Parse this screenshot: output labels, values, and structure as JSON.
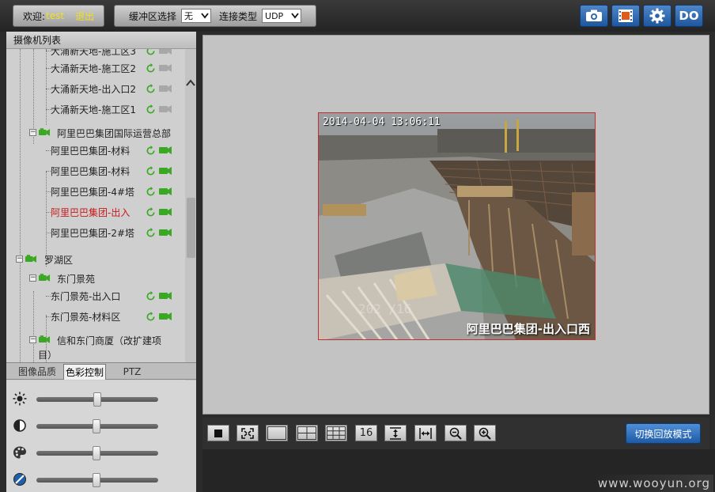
{
  "topbar": {
    "welcome_label": "欢迎:",
    "username": "test",
    "logout_label": "退出",
    "buffer_label": "缓冲区选择",
    "buffer_value": "无",
    "conn_label": "连接类型",
    "conn_value": "UDP",
    "do_label": "DO",
    "icons": [
      "camera-icon",
      "film-icon",
      "gear-icon",
      "do-icon"
    ]
  },
  "camera_list": {
    "title": "摄像机列表",
    "items": [
      {
        "label": "大涌新天地-施工区3",
        "status": "offline"
      },
      {
        "label": "大涌新天地-施工区2",
        "status": "offline"
      },
      {
        "label": "大涌新天地-出入口2",
        "status": "offline"
      },
      {
        "label": "大涌新天地-施工区1",
        "status": "offline"
      },
      {
        "label": "阿里巴巴集团国际运营总部",
        "type": "group"
      },
      {
        "label": "阿里巴巴集团-材料",
        "status": "online"
      },
      {
        "label": "阿里巴巴集团-材料",
        "status": "online"
      },
      {
        "label": "阿里巴巴集团-4#塔",
        "status": "online"
      },
      {
        "label": "阿里巴巴集团-出入",
        "status": "online",
        "selected": true
      },
      {
        "label": "阿里巴巴集团-2#塔",
        "status": "online"
      },
      {
        "label": "罗湖区",
        "type": "group"
      },
      {
        "label": "东门景苑",
        "type": "group"
      },
      {
        "label": "东门景苑-出入口",
        "status": "online"
      },
      {
        "label": "东门景苑-材料区",
        "status": "online"
      },
      {
        "label": "信和东门商厦（改扩建项",
        "type": "group"
      },
      {
        "label": "目）",
        "type": "continuation"
      }
    ],
    "colors": {
      "selected": "#c81a1a",
      "online": "#3aa822",
      "offline": "#a8a8a8"
    }
  },
  "tabs": [
    {
      "label": "图像品质"
    },
    {
      "label": "色彩控制",
      "active": true
    },
    {
      "label": "PTZ"
    }
  ],
  "sliders": [
    {
      "name": "brightness",
      "icon": "sun-icon",
      "value": 0.5
    },
    {
      "name": "contrast",
      "icon": "contrast-icon",
      "value": 0.49
    },
    {
      "name": "saturation",
      "icon": "palette-icon",
      "value": 0.49
    },
    {
      "name": "hue",
      "icon": "hue-icon",
      "value": 0.49
    }
  ],
  "video": {
    "timestamp": "2014-04-04 13:06:11",
    "camera_name": "阿里巴巴集团-出入口西",
    "overlay": "202 /16"
  },
  "controls": {
    "buttons": [
      {
        "icon": "stop-icon"
      },
      {
        "icon": "fullscreen-icon"
      },
      {
        "icon": "layout-1-icon"
      },
      {
        "icon": "layout-4-icon"
      },
      {
        "icon": "layout-9-icon"
      },
      {
        "icon": "layout-16-icon",
        "label": "16"
      },
      {
        "icon": "fit-vertical-icon"
      },
      {
        "icon": "fit-horizontal-icon"
      },
      {
        "icon": "zoom-out-icon"
      },
      {
        "icon": "zoom-in-icon"
      }
    ],
    "switch_label": "切换回放模式"
  },
  "watermark": "www.wooyun.org"
}
